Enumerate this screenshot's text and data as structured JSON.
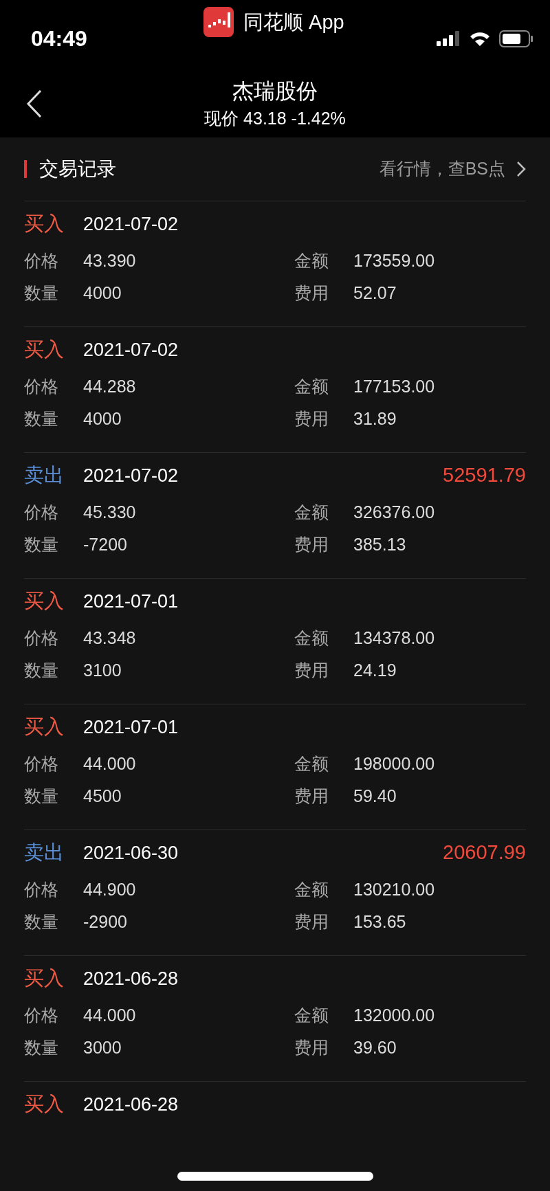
{
  "status_bar": {
    "time": "04:49",
    "app_name": "同花顺 App"
  },
  "header": {
    "title": "杰瑞股份",
    "subtitle": "现价 43.18 -1.42%"
  },
  "section": {
    "title": "交易记录",
    "link": "看行情，查BS点"
  },
  "records": [
    {
      "kind": "buy",
      "type": "买入",
      "date": "2021-07-02",
      "fields": [
        {
          "label": "价格",
          "value": "43.390"
        },
        {
          "label": "金额",
          "value": "173559.00"
        },
        {
          "label": "数量",
          "value": "4000"
        },
        {
          "label": "费用",
          "value": "52.07"
        }
      ]
    },
    {
      "kind": "buy",
      "type": "买入",
      "date": "2021-07-02",
      "fields": [
        {
          "label": "价格",
          "value": "44.288"
        },
        {
          "label": "金额",
          "value": "177153.00"
        },
        {
          "label": "数量",
          "value": "4000"
        },
        {
          "label": "费用",
          "value": "31.89"
        }
      ]
    },
    {
      "kind": "sell",
      "type": "卖出",
      "date": "2021-07-02",
      "profit": "52591.79",
      "fields": [
        {
          "label": "价格",
          "value": "45.330"
        },
        {
          "label": "金额",
          "value": "326376.00"
        },
        {
          "label": "数量",
          "value": "-7200"
        },
        {
          "label": "费用",
          "value": "385.13"
        }
      ]
    },
    {
      "kind": "buy",
      "type": "买入",
      "date": "2021-07-01",
      "fields": [
        {
          "label": "价格",
          "value": "43.348"
        },
        {
          "label": "金额",
          "value": "134378.00"
        },
        {
          "label": "数量",
          "value": "3100"
        },
        {
          "label": "费用",
          "value": "24.19"
        }
      ]
    },
    {
      "kind": "buy",
      "type": "买入",
      "date": "2021-07-01",
      "fields": [
        {
          "label": "价格",
          "value": "44.000"
        },
        {
          "label": "金额",
          "value": "198000.00"
        },
        {
          "label": "数量",
          "value": "4500"
        },
        {
          "label": "费用",
          "value": "59.40"
        }
      ]
    },
    {
      "kind": "sell",
      "type": "卖出",
      "date": "2021-06-30",
      "profit": "20607.99",
      "fields": [
        {
          "label": "价格",
          "value": "44.900"
        },
        {
          "label": "金额",
          "value": "130210.00"
        },
        {
          "label": "数量",
          "value": "-2900"
        },
        {
          "label": "费用",
          "value": "153.65"
        }
      ]
    },
    {
      "kind": "buy",
      "type": "买入",
      "date": "2021-06-28",
      "fields": [
        {
          "label": "价格",
          "value": "44.000"
        },
        {
          "label": "金额",
          "value": "132000.00"
        },
        {
          "label": "数量",
          "value": "3000"
        },
        {
          "label": "费用",
          "value": "39.60"
        }
      ]
    },
    {
      "kind": "buy",
      "type": "买入",
      "date": "2021-06-28"
    }
  ]
}
